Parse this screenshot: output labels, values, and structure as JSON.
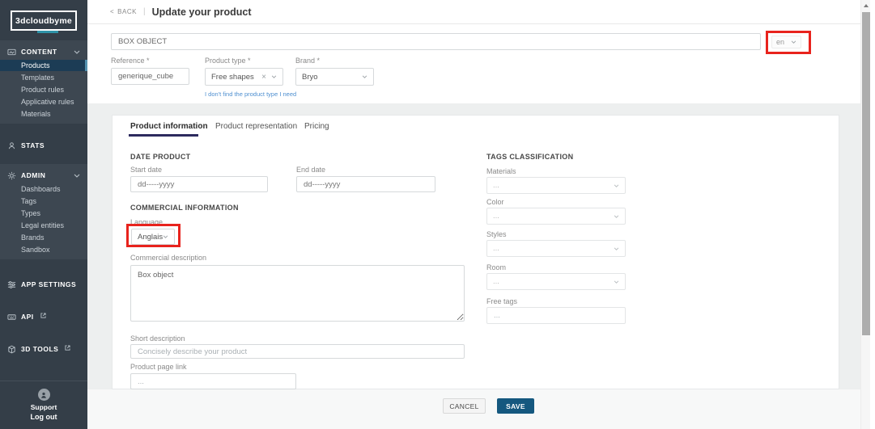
{
  "sidebar": {
    "logo": "3dcloudbyme",
    "content": {
      "label": "CONTENT",
      "items": [
        "Products",
        "Templates",
        "Product rules",
        "Applicative rules",
        "Materials"
      ]
    },
    "stats_label": "STATS",
    "admin": {
      "label": "ADMIN",
      "items": [
        "Dashboards",
        "Tags",
        "Types",
        "Legal entities",
        "Brands",
        "Sandbox"
      ]
    },
    "app_settings_label": "APP SETTINGS",
    "api_label": "API",
    "tools_label": "3D TOOLS",
    "support_label": "Support",
    "logout_label": "Log out"
  },
  "header": {
    "back_label": "BACK",
    "separator": "|",
    "title": "Update your product"
  },
  "product_header": {
    "name_value": "BOX OBJECT",
    "language_code": "en",
    "reference": {
      "label": "Reference *",
      "value": "generique_cube"
    },
    "product_type": {
      "label": "Product type *",
      "value": "Free shapes",
      "clear": "×",
      "help_link": "I don't find the product type I need"
    },
    "brand": {
      "label": "Brand *",
      "value": "Bryo"
    }
  },
  "tabs": {
    "items": [
      "Product information",
      "Product representation",
      "Pricing"
    ]
  },
  "form": {
    "date_section_title": "DATE PRODUCT",
    "start_date": {
      "label": "Start date",
      "placeholder": "dd-----yyyy"
    },
    "end_date": {
      "label": "End date",
      "placeholder": "dd-----yyyy"
    },
    "commercial_section_title": "COMMERCIAL INFORMATION",
    "language": {
      "label": "Language",
      "value": "Anglais"
    },
    "commercial_description": {
      "label": "Commercial description",
      "value": "Box object"
    },
    "short_description": {
      "label": "Short description",
      "placeholder": "Concisely describe your product"
    },
    "product_page_link": {
      "label": "Product page link",
      "placeholder": "..."
    }
  },
  "tags": {
    "section_title": "TAGS CLASSIFICATION",
    "fields": [
      {
        "label": "Materials",
        "value": "..."
      },
      {
        "label": "Color",
        "value": "..."
      },
      {
        "label": "Styles",
        "value": "..."
      },
      {
        "label": "Room",
        "value": "..."
      }
    ],
    "free_tags": {
      "label": "Free tags",
      "placeholder": "..."
    }
  },
  "footer": {
    "cancel_label": "CANCEL",
    "save_label": "SAVE"
  },
  "colors": {
    "accent_teal": "#2E93A8",
    "selected_nav_bg": "#1C3C55",
    "selected_nav_bar": "#5390AE",
    "save_blue": "#15587F",
    "annotation_red": "#E8231D",
    "tab_underline": "#2D2A5E",
    "link_blue": "#4E8FD0"
  }
}
